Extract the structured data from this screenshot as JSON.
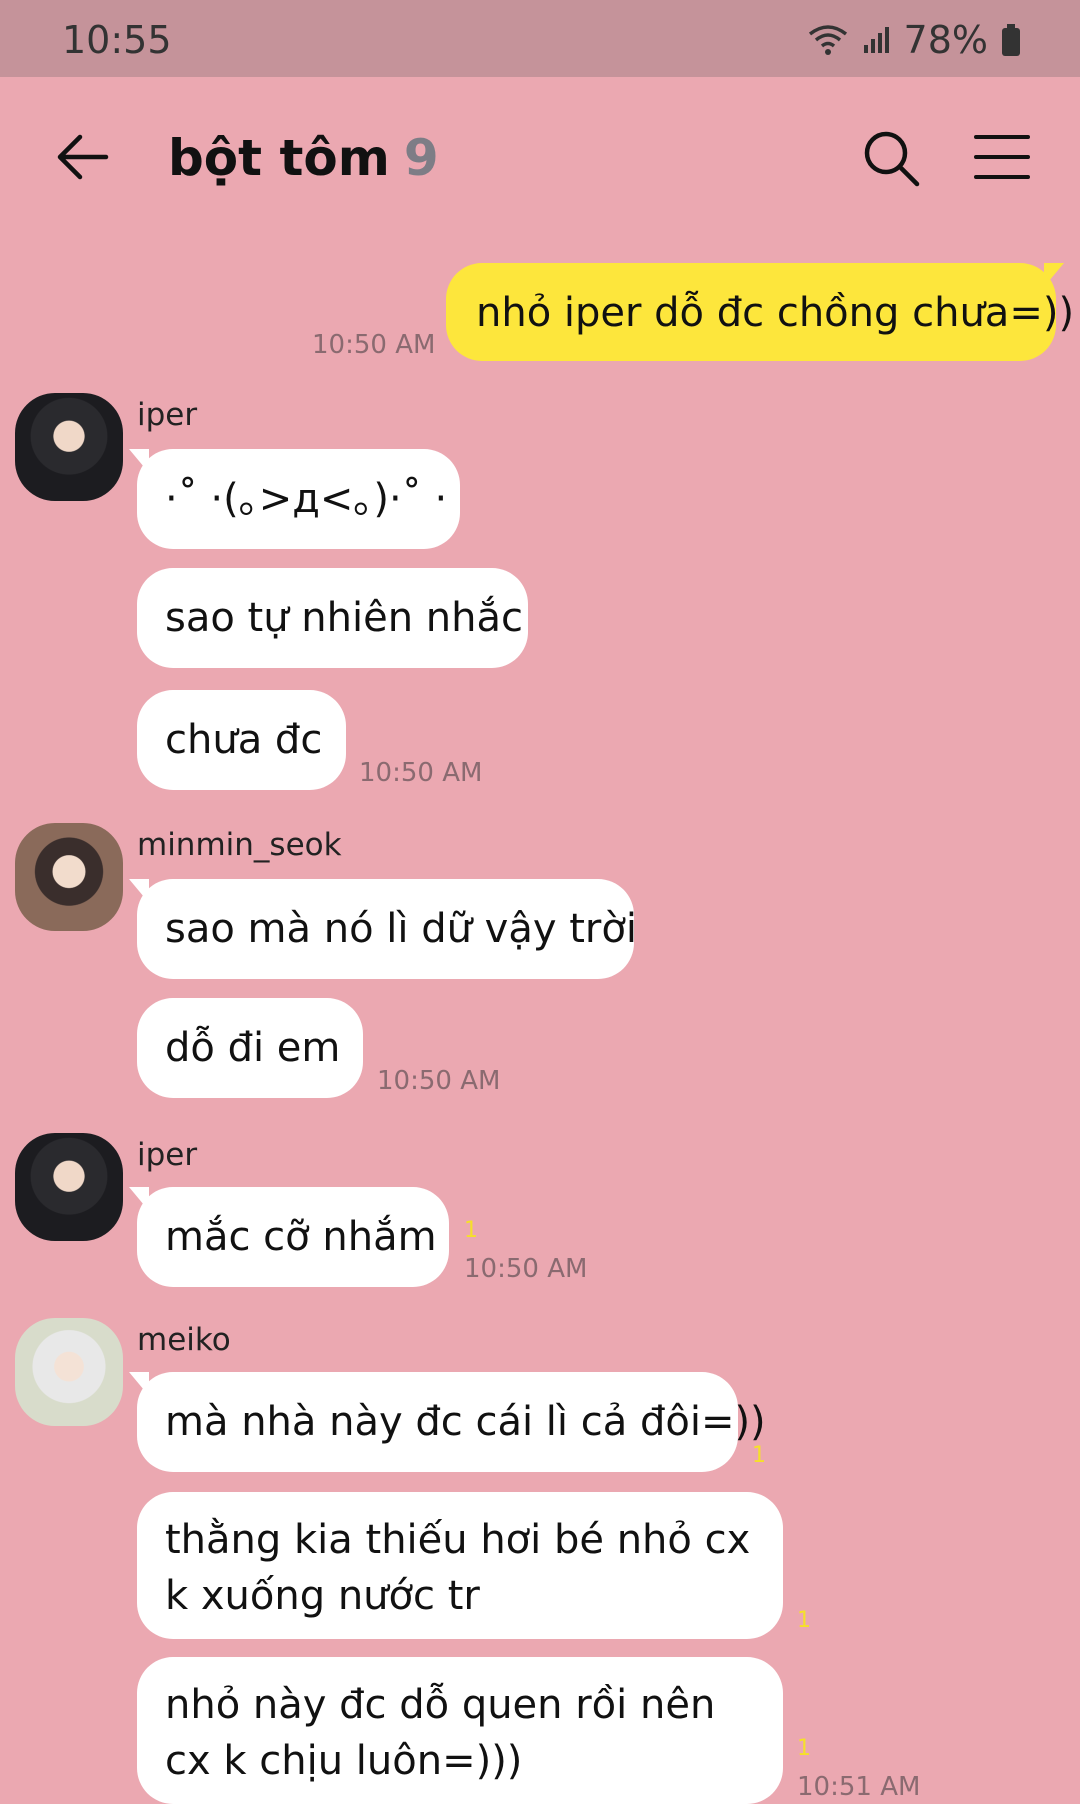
{
  "status_bar": {
    "time": "10:55",
    "battery": "78%"
  },
  "header": {
    "title": "bột tôm",
    "member_count": "9"
  },
  "messages": {
    "m1": {
      "text": "nhỏ iper dỗ đc chồng chưa=))",
      "time": "10:50 AM"
    },
    "g1": {
      "sender": "iper",
      "b1": "·˚ ·(｡>д<｡)·˚ ·",
      "b2": "sao tự nhiên nhắc",
      "b3": "chưa đc",
      "time": "10:50 AM"
    },
    "g2": {
      "sender": "minmin_seok",
      "b1": "sao mà nó lì dữ vậy trời",
      "b2": "dỗ đi em",
      "time": "10:50 AM"
    },
    "g3": {
      "sender": "iper",
      "b1": "mắc cỡ nhắm",
      "unread": "1",
      "time": "10:50 AM"
    },
    "g4": {
      "sender": "meiko",
      "b1": "mà nhà này đc cái lì cả đôi=))",
      "b1_unread": "1",
      "b2": "thằng kia thiếu hơi bé nhỏ cx k xuống nước tr",
      "b2_unread": "1",
      "b3": "nhỏ này đc dỗ quen rồi nên cx k chịu luôn=)))",
      "b3_unread": "1",
      "time": "10:51 AM"
    }
  },
  "colors": {
    "background": "#eba8b1",
    "status_bar": "#c5939a",
    "my_bubble": "#fde63c",
    "their_bubble": "#ffffff",
    "unread": "#f5e02a"
  },
  "icons": {
    "back": "arrow-left-icon",
    "search": "search-icon",
    "menu": "hamburger-menu-icon",
    "wifi": "wifi-icon",
    "signal": "signal-icon",
    "battery": "battery-icon"
  }
}
